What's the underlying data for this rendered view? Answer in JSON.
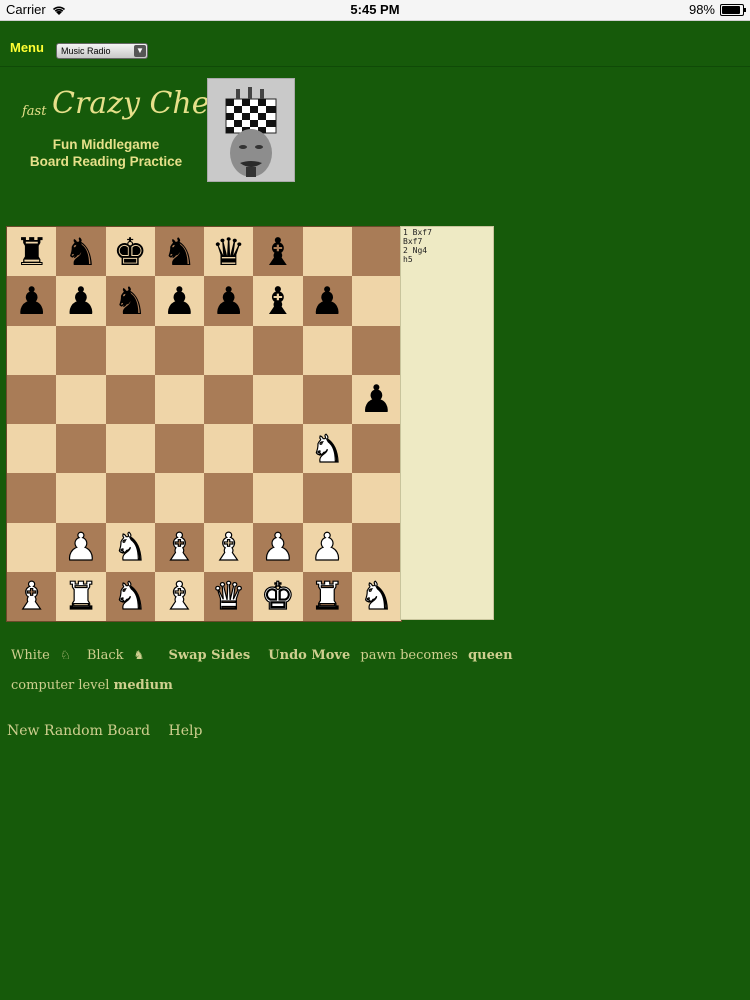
{
  "status_bar": {
    "carrier": "Carrier",
    "time": "5:45 PM",
    "battery": "98%"
  },
  "topbar": {
    "menu_label": "Menu",
    "music_select_value": "Music Radio"
  },
  "branding": {
    "logo_fast": "fast",
    "logo_title": "Crazy Chess",
    "subtitle_line1": "Fun Middlegame",
    "subtitle_line2": "Board Reading Practice"
  },
  "board": {
    "rows": [
      [
        "br",
        "bn",
        "bk",
        "bn",
        "bq",
        "bb",
        "",
        ""
      ],
      [
        "bp",
        "bp",
        "bn",
        "bp",
        "bp",
        "bb",
        "bp",
        ""
      ],
      [
        "",
        "",
        "",
        "",
        "",
        "",
        "",
        ""
      ],
      [
        "",
        "",
        "",
        "",
        "",
        "",
        "",
        "bp"
      ],
      [
        "",
        "",
        "",
        "",
        "",
        "",
        "wn",
        ""
      ],
      [
        "",
        "",
        "",
        "",
        "",
        "",
        "",
        ""
      ],
      [
        "",
        "wp",
        "wn",
        "wb",
        "wb",
        "wp",
        "wp",
        ""
      ],
      [
        "wb",
        "wr",
        "wn",
        "wb",
        "wq",
        "wk",
        "wr",
        "wn"
      ]
    ]
  },
  "moves": [
    "1 Bxf7",
    "Bxf7",
    "2 Ng4",
    "h5"
  ],
  "controls": {
    "white_label": "White",
    "black_label": "Black",
    "swap_sides": "Swap Sides",
    "undo_move": "Undo Move",
    "pawn_becomes": "pawn becomes",
    "promotion_piece": "queen",
    "computer_level_label": "computer level",
    "computer_level_value": "medium"
  },
  "links": {
    "new_random_board": "New Random Board",
    "help": "Help"
  },
  "colors": {
    "background": "#165a0a",
    "light_square": "#efd5a8",
    "dark_square": "#a97c57",
    "accent_yellow": "#ffff33",
    "text_khaki": "#cfcf8f"
  }
}
